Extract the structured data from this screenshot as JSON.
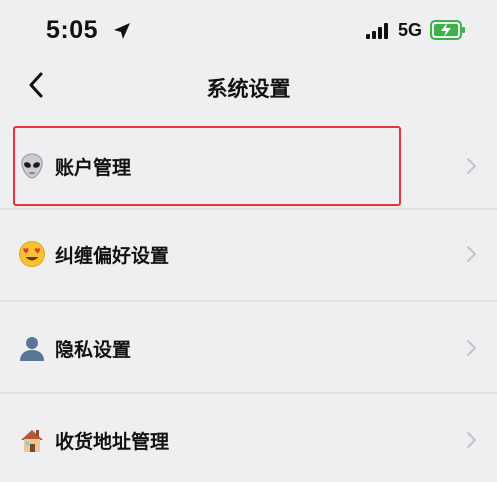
{
  "status_bar": {
    "time": "5:05",
    "network": "5G",
    "icons": [
      "location-arrow-icon",
      "cellular-signal-icon",
      "battery-charging-icon"
    ],
    "battery_color": "#3bb34a"
  },
  "nav": {
    "back_icon": "chevron-left-icon",
    "title": "系统设置"
  },
  "settings": {
    "items": [
      {
        "label": "账户管理",
        "icon": "alien-emoji-icon",
        "highlighted": true
      },
      {
        "label": "纠缠偏好设置",
        "icon": "heart-eyes-emoji-icon",
        "highlighted": false
      },
      {
        "label": "隐私设置",
        "icon": "person-silhouette-emoji-icon",
        "highlighted": false
      },
      {
        "label": "收货地址管理",
        "icon": "house-emoji-icon",
        "highlighted": false
      }
    ]
  },
  "colors": {
    "background": "#efeff1",
    "highlight_border": "#e8333a",
    "chevron": "#c4c4c8",
    "divider": "#e2e2e5"
  }
}
